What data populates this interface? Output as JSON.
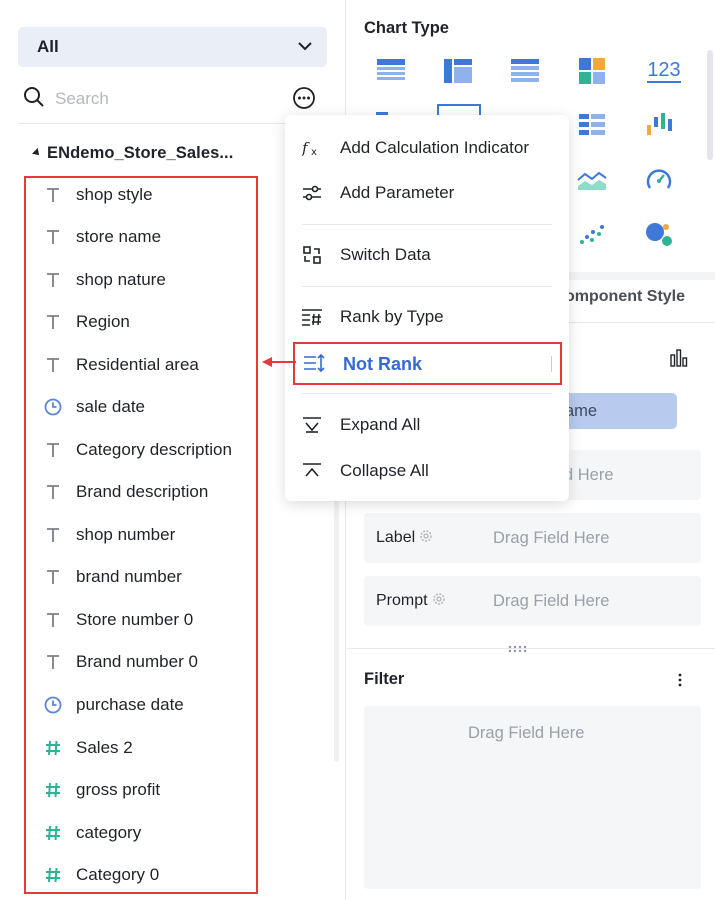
{
  "left_panel": {
    "dataset_select": {
      "value": "All"
    },
    "search": {
      "placeholder": "Search"
    },
    "dataset_name": "ENdemo_Store_Sales...",
    "fields": [
      {
        "label": "shop style",
        "type": "text"
      },
      {
        "label": "store name",
        "type": "text"
      },
      {
        "label": "shop nature",
        "type": "text"
      },
      {
        "label": "Region",
        "type": "text"
      },
      {
        "label": "Residential area",
        "type": "text"
      },
      {
        "label": "sale date",
        "type": "date"
      },
      {
        "label": "Category description",
        "type": "text"
      },
      {
        "label": "Brand description",
        "type": "text"
      },
      {
        "label": "shop number",
        "type": "text"
      },
      {
        "label": "brand number",
        "type": "text"
      },
      {
        "label": "Store number 0",
        "type": "text"
      },
      {
        "label": "Brand number 0",
        "type": "text"
      },
      {
        "label": "purchase date",
        "type": "date"
      },
      {
        "label": "Sales 2",
        "type": "number"
      },
      {
        "label": "gross profit",
        "type": "number"
      },
      {
        "label": "category",
        "type": "number"
      },
      {
        "label": "Category 0",
        "type": "number"
      }
    ]
  },
  "context_menu": {
    "items": [
      {
        "label": "Add Calculation Indicator",
        "icon": "fx-icon"
      },
      {
        "label": "Add Parameter",
        "icon": "parameter-sliders-icon"
      },
      {
        "label": "Switch Data",
        "icon": "switch-data-icon"
      },
      {
        "label": "Rank by Type",
        "icon": "rank-by-type-icon"
      },
      {
        "label": "Not Rank",
        "icon": "not-rank-icon",
        "highlighted": true
      },
      {
        "label": "Expand All",
        "icon": "expand-all-icon"
      },
      {
        "label": "Collapse All",
        "icon": "collapse-all-icon"
      }
    ]
  },
  "right_panel": {
    "chart_type_title": "Chart Type",
    "number_chart_label": "123",
    "component_style_tab": "omponent Style",
    "field_chip": "ame",
    "drop_zones": [
      {
        "label": "",
        "placeholder": "d Here"
      },
      {
        "label": "Label",
        "placeholder": "Drag Field Here"
      },
      {
        "label": "Prompt",
        "placeholder": "Drag Field Here"
      }
    ],
    "filter": {
      "title": "Filter",
      "placeholder": "Drag Field Here"
    }
  },
  "colors": {
    "accent_blue": "#3769d6",
    "highlight_red": "#e5393e",
    "text_icon_gray": "#7a8089",
    "date_icon_blue": "#5a86d9",
    "number_icon_green": "#2eb395"
  }
}
